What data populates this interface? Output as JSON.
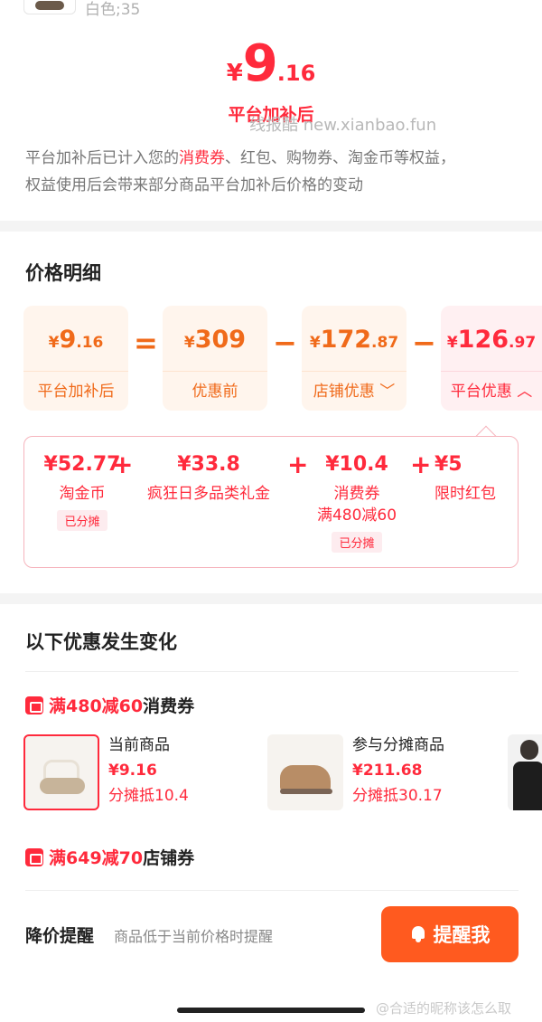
{
  "top": {
    "sku": "白色;35"
  },
  "hero": {
    "symbol": "¥",
    "integer": "9",
    "decimal": ".16",
    "caption": "平台加补后",
    "watermark": "线报酷 new.xianbao.fun"
  },
  "note": {
    "line1_before": "平台加补后已计入您的",
    "line1_highlight": "消费券",
    "line1_after": "、红包、购物券、淘金币等权益，",
    "line2": "权益使用后会带来部分商品平台加补后价格的变动"
  },
  "price_detail": {
    "title": "价格明细",
    "cards": [
      {
        "symbol": "¥",
        "int": "9",
        "dec": ".16",
        "label": "平台加补后"
      },
      {
        "symbol": "¥",
        "int": "309",
        "dec": "",
        "label": "优惠前"
      },
      {
        "symbol": "¥",
        "int": "172",
        "dec": ".87",
        "label": "店铺优惠"
      },
      {
        "symbol": "¥",
        "int": "126",
        "dec": ".97",
        "label": "平台优惠"
      }
    ],
    "operators": [
      "=",
      "−",
      "−"
    ],
    "chevrons": {
      "shop": "chevron-down",
      "platform": "chevron-up"
    }
  },
  "breakdown": {
    "items": [
      {
        "value": "¥52.77",
        "title": "淘金币",
        "tag": "已分摊"
      },
      {
        "value": "¥33.8",
        "title": "疯狂日多品类礼金"
      },
      {
        "value": "¥10.4",
        "title": "消费券",
        "sub": "满480减60",
        "tag": "已分摊"
      },
      {
        "value": "¥5",
        "title": "限时红包"
      }
    ],
    "plus": "+"
  },
  "changes": {
    "title": "以下优惠发生变化",
    "coupon1": {
      "highlight": "满480减60",
      "suffix": "消费券",
      "products": [
        {
          "name": "当前商品",
          "price": "¥9.16",
          "share": "分摊抵10.4"
        },
        {
          "name": "参与分摊商品",
          "price": "¥211.68",
          "share": "分摊抵30.17"
        }
      ]
    },
    "coupon2": {
      "highlight": "满649减70",
      "suffix": "店铺券"
    }
  },
  "reminder": {
    "title": "降价提醒",
    "subtitle": "商品低于当前价格时提醒",
    "button": "提醒我"
  },
  "footer": {
    "watermark": "@合适的昵称该怎么取"
  },
  "colors": {
    "red": "#ff2a3c",
    "orange": "#f06a1a",
    "button": "#ff5a1f"
  }
}
